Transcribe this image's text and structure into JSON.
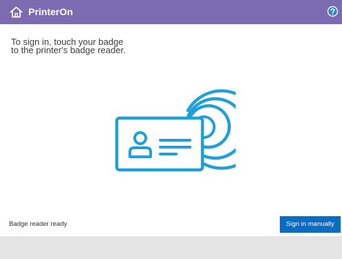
{
  "header": {
    "title": "PrinterOn",
    "home_icon": "home-icon",
    "help_icon": "help-icon",
    "background_color": "#7c6bb0"
  },
  "main": {
    "instruction_lines": [
      "To sign in, touch your badge",
      "to the printer's badge reader."
    ],
    "illustration_icon": "badge-contactless-icon",
    "illustration_color": "#1fa0d8"
  },
  "footer": {
    "status": "Badge reader ready",
    "sign_in_label": "Sign in manually",
    "accent_color": "#0a6cc2"
  }
}
